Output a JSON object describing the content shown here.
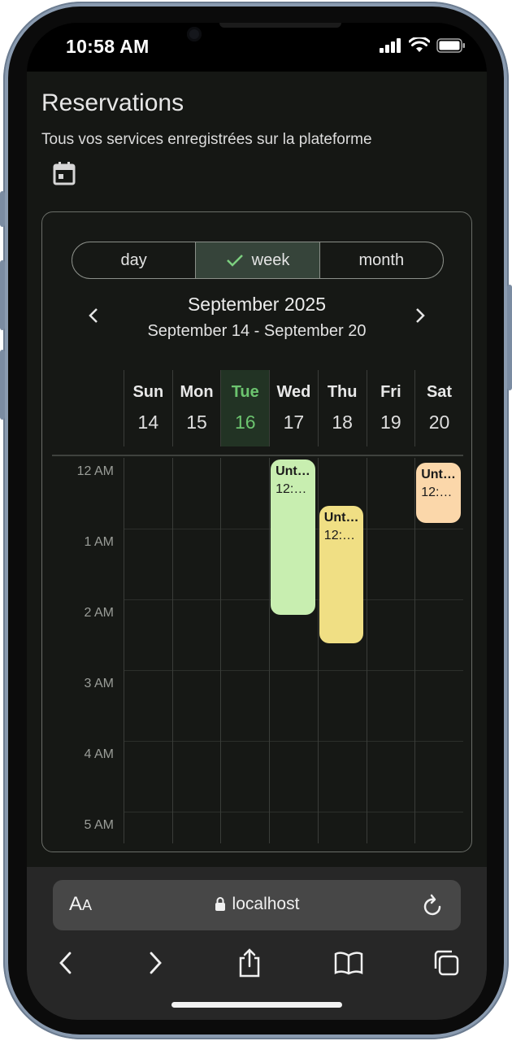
{
  "status": {
    "time": "10:58 AM"
  },
  "app": {
    "title": "Reservations",
    "subtitle": "Tous vos services enregistrées sur la plateforme",
    "icon": "calendar-icon"
  },
  "calendar": {
    "views": [
      {
        "label": "day",
        "active": false
      },
      {
        "label": "week",
        "active": true
      },
      {
        "label": "month",
        "active": false
      }
    ],
    "month_title": "September 2025",
    "range": "September 14 - September 20",
    "days": [
      {
        "name": "Sun",
        "num": "14",
        "today": false
      },
      {
        "name": "Mon",
        "num": "15",
        "today": false
      },
      {
        "name": "Tue",
        "num": "16",
        "today": true
      },
      {
        "name": "Wed",
        "num": "17",
        "today": false
      },
      {
        "name": "Thu",
        "num": "18",
        "today": false
      },
      {
        "name": "Fri",
        "num": "19",
        "today": false
      },
      {
        "name": "Sat",
        "num": "20",
        "today": false
      }
    ],
    "hours": [
      "12 AM",
      "1 AM",
      "2 AM",
      "3 AM",
      "4 AM",
      "5 AM"
    ],
    "events": [
      {
        "day": 3,
        "start": 0.0,
        "end": 2.2,
        "title": "Unt…",
        "time": "12:…",
        "color": "#c8eeb0"
      },
      {
        "day": 4,
        "start": 0.65,
        "end": 2.6,
        "title": "Unt…",
        "time": "12:…",
        "color": "#f0df84"
      },
      {
        "day": 6,
        "start": 0.05,
        "end": 0.9,
        "title": "Unt…",
        "time": "12:…",
        "color": "#fbd7aa"
      }
    ],
    "today_color": "#6cc46f"
  },
  "browser": {
    "text_size_label": "AA",
    "url": "localhost"
  }
}
